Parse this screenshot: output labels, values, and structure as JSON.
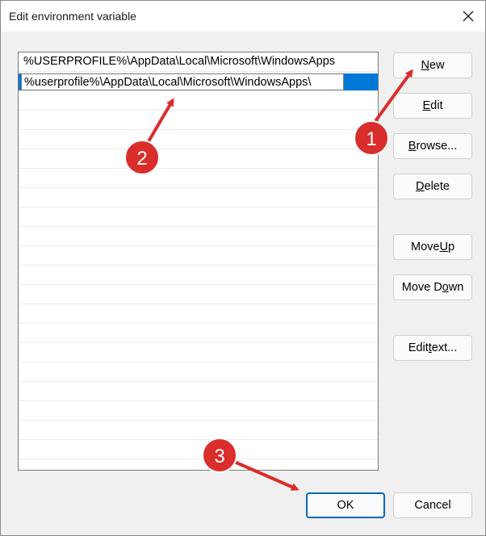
{
  "window": {
    "title": "Edit environment variable",
    "close_glyph": "✕"
  },
  "list": {
    "items": [
      "%USERPROFILE%\\AppData\\Local\\Microsoft\\WindowsApps"
    ],
    "editing_value": "%userprofile%\\AppData\\Local\\Microsoft\\WindowsApps\\",
    "selection_color": "#0078d7"
  },
  "buttons": {
    "new": {
      "pre": "",
      "key": "N",
      "post": "ew"
    },
    "edit": {
      "pre": "",
      "key": "E",
      "post": "dit"
    },
    "browse": {
      "pre": "",
      "key": "B",
      "post": "rowse..."
    },
    "delete": {
      "pre": "",
      "key": "D",
      "post": "elete"
    },
    "move_up": {
      "pre": "Move ",
      "key": "U",
      "post": "p"
    },
    "move_down": {
      "pre": "Move D",
      "key": "o",
      "post": "wn"
    },
    "edit_text": {
      "pre": "Edit ",
      "key": "t",
      "post": "ext..."
    },
    "ok": "OK",
    "cancel": "Cancel"
  },
  "annotations": {
    "marker_color": "#d92e2b",
    "arrow_color": "#d92e2b",
    "markers": [
      "1",
      "2",
      "3"
    ]
  }
}
